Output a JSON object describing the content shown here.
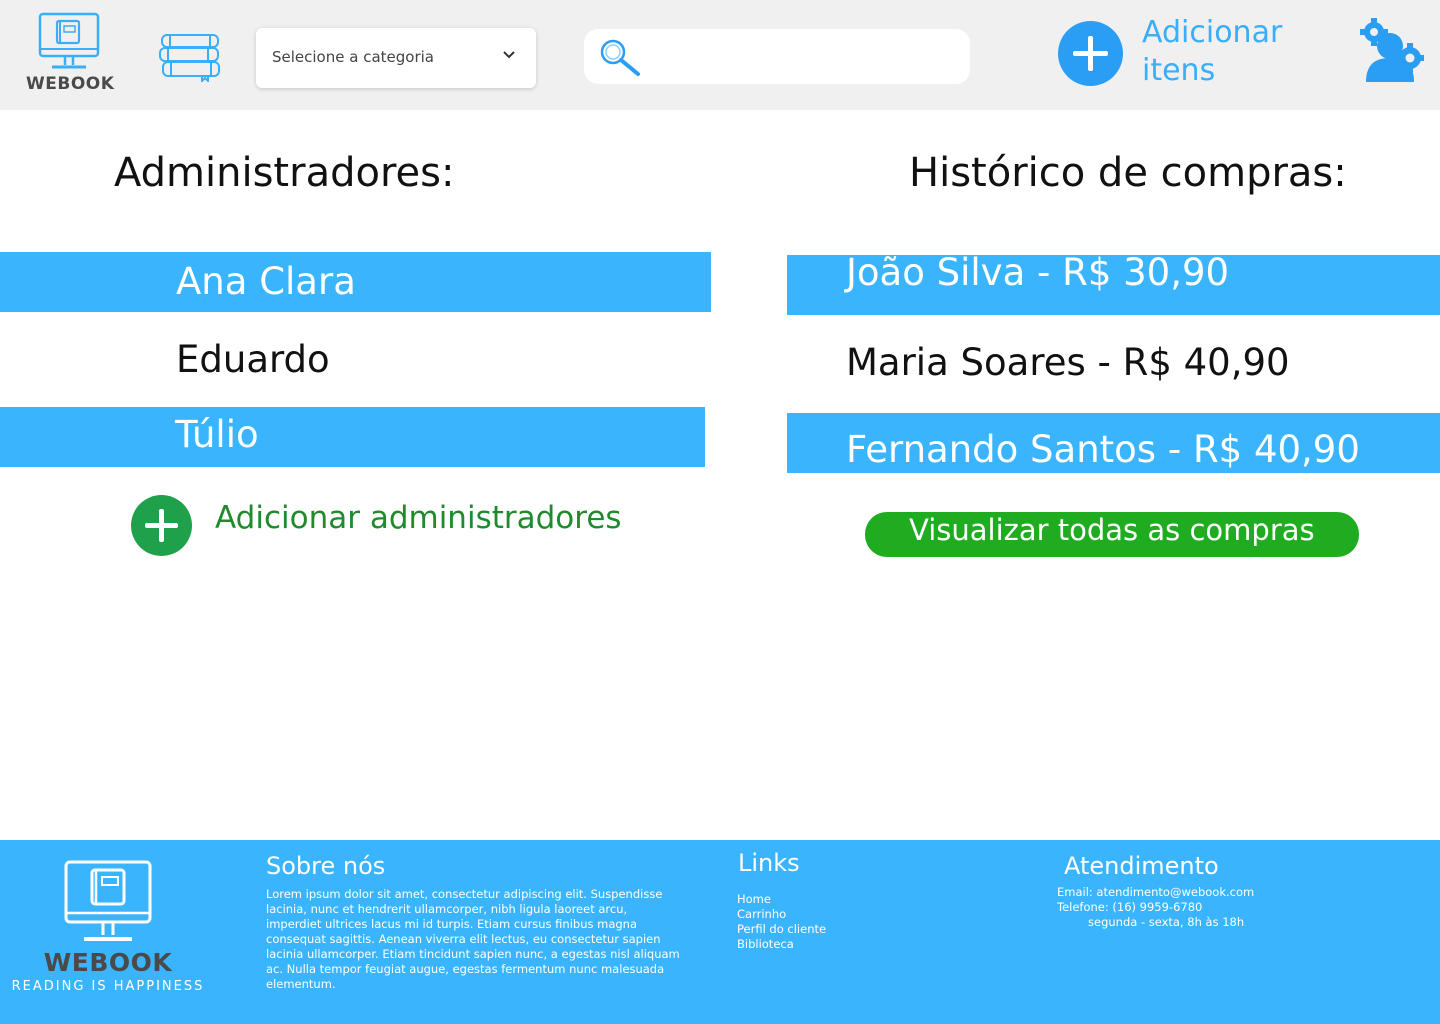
{
  "header": {
    "logo_text": "WEBOOK",
    "category_select": {
      "label": "Selecione a categoria"
    },
    "search": {
      "value": "",
      "placeholder": ""
    },
    "add_items_label_line1": "Adicionar",
    "add_items_label_line2": "itens"
  },
  "admins": {
    "title": "Administradores:",
    "items": [
      {
        "name": "Ana Clara"
      },
      {
        "name": "Eduardo"
      },
      {
        "name": "Túlio"
      }
    ],
    "add_label": "Adicionar administradores"
  },
  "history": {
    "title": "Histórico de compras:",
    "items": [
      {
        "text": "João Silva - R$ 30,90"
      },
      {
        "text": "Maria Soares -  R$ 40,90"
      },
      {
        "text": "Fernando Santos - R$ 40,90"
      }
    ],
    "view_all_label": "Visualizar todas as compras"
  },
  "footer": {
    "brand": "WEBOOK",
    "tagline": "READING IS HAPPINESS",
    "about": {
      "title": "Sobre nós",
      "text": "Lorem ipsum dolor sit amet, consectetur adipiscing elit. Suspendisse lacinia, nunc et hendrerit ullamcorper, nibh ligula laoreet arcu, imperdiet ultrices lacus mi id turpis. Etiam cursus finibus magna consequat sagittis. Aenean viverra elit lectus, eu consectetur sapien lacinia ullamcorper. Etiam tincidunt sapien nunc, a egestas nisl aliquam ac. Nulla tempor feugiat augue, egestas fermentum nunc malesuada elementum."
    },
    "links": {
      "title": "Links",
      "items": [
        "Home",
        "Carrinho",
        "Perfil do cliente",
        "Biblioteca"
      ]
    },
    "service": {
      "title": "Atendimento",
      "email": "Email: atendimento@webook.com",
      "phone": "Telefone: (16) 9959-6780",
      "hours": "segunda - sexta, 8h às 18h"
    }
  },
  "colors": {
    "header_bg": "#f0f0f0",
    "accent_blue": "#3ab5fd",
    "icon_blue": "#2a9df4",
    "green_button": "#20ac20",
    "green_text": "#208a2d"
  },
  "icons": {
    "logo": "monitor-book-icon",
    "library": "books-stack-icon",
    "dropdown": "chevron-down-icon",
    "search": "search-icon",
    "add": "plus-circle-icon",
    "admin": "user-settings-icon"
  }
}
